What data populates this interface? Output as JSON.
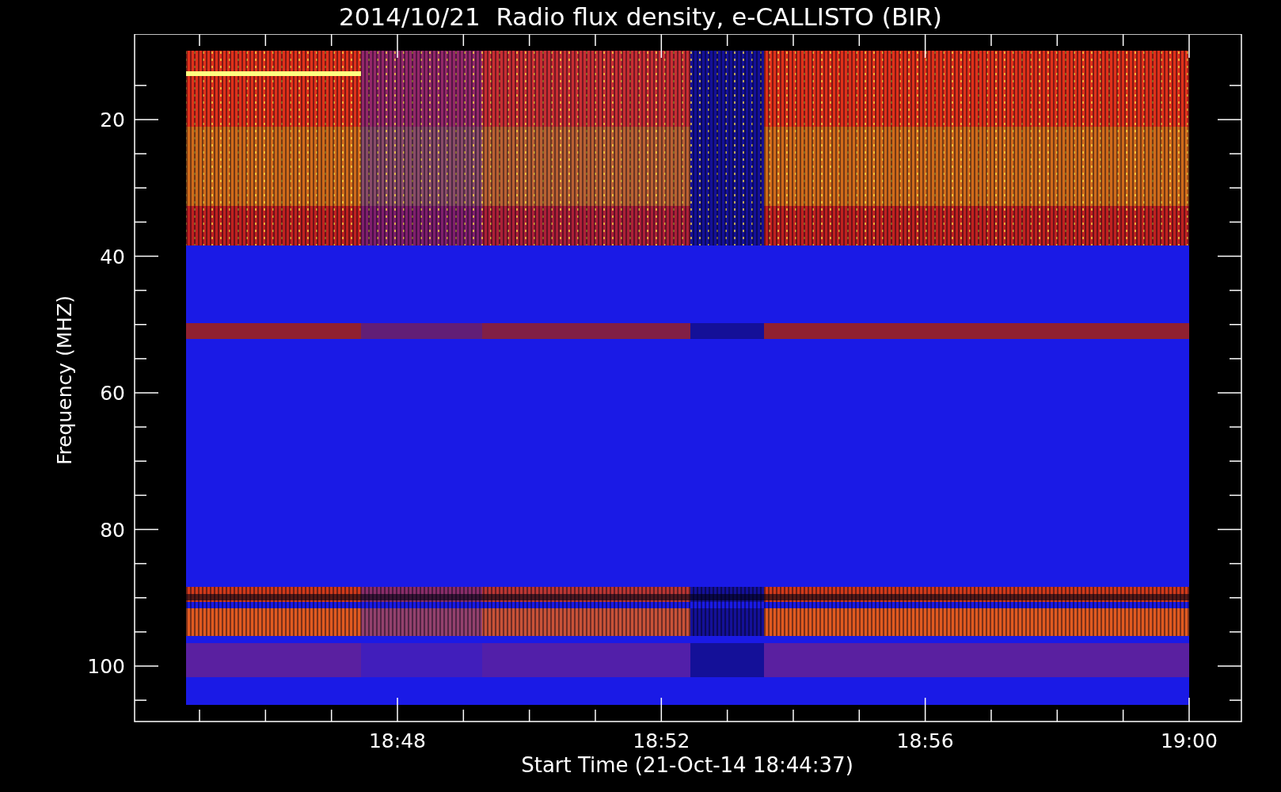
{
  "title": "2014/10/21  Radio flux density, e-CALLISTO (BIR)",
  "y_axis": {
    "label": "Frequency (MHZ)",
    "ticks": [
      "20",
      "40",
      "60",
      "80",
      "100"
    ]
  },
  "x_axis": {
    "label": "Start Time (21-Oct-14 18:44:37)",
    "ticks": [
      "18:48",
      "18:52",
      "18:56",
      "19:00"
    ]
  }
}
